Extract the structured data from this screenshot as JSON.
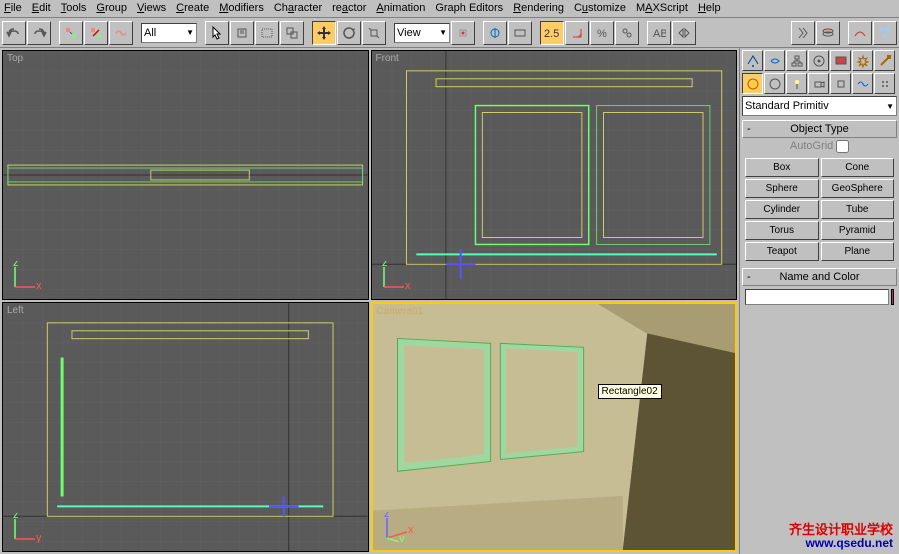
{
  "menu": [
    "File",
    "Edit",
    "Tools",
    "Group",
    "Views",
    "Create",
    "Modifiers",
    "Character",
    "reactor",
    "Animation",
    "Graph Editors",
    "Rendering",
    "Customize",
    "MAXScript",
    "Help"
  ],
  "toolbar": {
    "selset": "All",
    "viewmode": "View",
    "snap": "2.5"
  },
  "viewports": {
    "top": "Top",
    "front": "Front",
    "left": "Left",
    "camera": "Camera01"
  },
  "tooltip": "Rectangle02",
  "panel": {
    "dropdown": "Standard Primitiv",
    "objtype_hdr": "Object Type",
    "autogrid": "AutoGrid",
    "buttons": [
      "Box",
      "Cone",
      "Sphere",
      "GeoSphere",
      "Cylinder",
      "Tube",
      "Torus",
      "Pyramid",
      "Teapot",
      "Plane"
    ],
    "namecolor_hdr": "Name and Color",
    "name_val": ""
  },
  "watermark": {
    "l1": "齐生设计职业学校",
    "l2": "www.qsedu.net"
  }
}
